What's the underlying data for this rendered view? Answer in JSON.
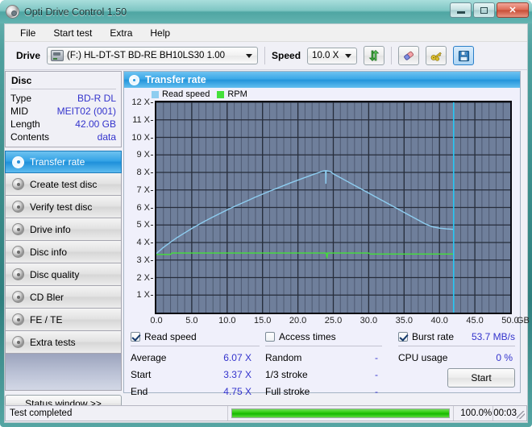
{
  "window": {
    "title": "Opti Drive Control 1.50",
    "icon": "disc-icon",
    "controls": {
      "minimize": "minimize",
      "maximize": "maximize",
      "close": "close"
    }
  },
  "menu": {
    "items": [
      "File",
      "Start test",
      "Extra",
      "Help"
    ]
  },
  "toolbar": {
    "drive_label": "Drive",
    "drive_value": "(F:)  HL-DT-ST BD-RE  BH10LS30 1.00",
    "speed_label": "Speed",
    "speed_value": "10.0 X",
    "buttons": [
      {
        "name": "refresh-button",
        "icon": "refresh-arrows-icon"
      },
      {
        "name": "erase-button",
        "icon": "eraser-icon"
      },
      {
        "name": "tools-button",
        "icon": "keys-icon"
      },
      {
        "name": "save-button",
        "icon": "floppy-disk-icon",
        "active": true
      }
    ]
  },
  "disc": {
    "title": "Disc",
    "rows": [
      {
        "key": "Type",
        "value": "BD-R DL"
      },
      {
        "key": "MID",
        "value": "MEIT02 (001)"
      },
      {
        "key": "Length",
        "value": "42.00 GB"
      },
      {
        "key": "Contents",
        "value": "data"
      }
    ]
  },
  "tabs": [
    {
      "label": "Transfer rate",
      "selected": true
    },
    {
      "label": "Create test disc",
      "selected": false
    },
    {
      "label": "Verify test disc",
      "selected": false
    },
    {
      "label": "Drive info",
      "selected": false
    },
    {
      "label": "Disc info",
      "selected": false
    },
    {
      "label": "Disc quality",
      "selected": false
    },
    {
      "label": "CD Bler",
      "selected": false
    },
    {
      "label": "FE / TE",
      "selected": false
    },
    {
      "label": "Extra tests",
      "selected": false
    }
  ],
  "status_window_button": "Status window >>",
  "panel": {
    "title": "Transfer rate"
  },
  "stats": {
    "read_speed": {
      "label": "Read speed",
      "checked": true,
      "rows": [
        {
          "key": "Average",
          "value": "6.07 X"
        },
        {
          "key": "Start",
          "value": "3.37 X"
        },
        {
          "key": "End",
          "value": "4.75 X"
        }
      ]
    },
    "access_times": {
      "label": "Access times",
      "checked": false,
      "rows": [
        {
          "key": "Random",
          "value": "-"
        },
        {
          "key": "1/3 stroke",
          "value": "-"
        },
        {
          "key": "Full stroke",
          "value": "-"
        }
      ]
    },
    "burst_rate": {
      "label": "Burst rate",
      "checked": true,
      "value": "53.7 MB/s",
      "cpu_key": "CPU usage",
      "cpu_value": "0 %"
    },
    "start_button": "Start"
  },
  "statusbar": {
    "text": "Test completed",
    "percent_label": "100.0%",
    "percent": 100,
    "time": "00:03"
  },
  "colors": {
    "read_speed": "#8ecdf0",
    "rpm": "#44e03a",
    "plot_bg": "#6f7f9b",
    "grid": "#3b4456",
    "marker": "#27c8f5",
    "value_text": "#3333cc",
    "accent": "#2394db"
  },
  "chart_data": {
    "type": "line",
    "title": "Transfer rate",
    "xlabel": "GB",
    "ylabel": "X",
    "xlim": [
      0.0,
      50.0
    ],
    "ylim": [
      0.0,
      12.0
    ],
    "xticks": [
      "0.0",
      "5.0",
      "10.0",
      "15.0",
      "20.0",
      "25.0",
      "30.0",
      "35.0",
      "40.0",
      "45.0",
      "50.0"
    ],
    "xtick_values": [
      0,
      5,
      10,
      15,
      20,
      25,
      30,
      35,
      40,
      45,
      50
    ],
    "yticks": [
      "1 X",
      "2 X",
      "3 X",
      "4 X",
      "5 X",
      "6 X",
      "7 X",
      "8 X",
      "9 X",
      "10 X",
      "11 X",
      "12 X"
    ],
    "ytick_values": [
      1,
      2,
      3,
      4,
      5,
      6,
      7,
      8,
      9,
      10,
      11,
      12
    ],
    "grid": true,
    "legend": [
      "Read speed",
      "RPM"
    ],
    "legend_position": "top-left",
    "marker_x": 42.0,
    "series": [
      {
        "name": "Read speed",
        "color": "#8ecdf0",
        "points": [
          [
            0.0,
            3.37
          ],
          [
            1.0,
            3.72
          ],
          [
            2.0,
            4.02
          ],
          [
            3.0,
            4.3
          ],
          [
            4.0,
            4.55
          ],
          [
            5.0,
            4.8
          ],
          [
            6.0,
            5.03
          ],
          [
            7.0,
            5.25
          ],
          [
            8.0,
            5.46
          ],
          [
            9.0,
            5.66
          ],
          [
            10.0,
            5.86
          ],
          [
            11.0,
            6.05
          ],
          [
            12.0,
            6.23
          ],
          [
            13.0,
            6.41
          ],
          [
            14.0,
            6.59
          ],
          [
            15.0,
            6.76
          ],
          [
            16.0,
            6.93
          ],
          [
            17.0,
            7.09
          ],
          [
            18.0,
            7.25
          ],
          [
            19.0,
            7.41
          ],
          [
            20.0,
            7.56
          ],
          [
            21.0,
            7.71
          ],
          [
            22.0,
            7.86
          ],
          [
            23.0,
            8.0
          ],
          [
            23.5,
            8.07
          ],
          [
            23.9,
            8.1
          ],
          [
            23.95,
            7.35
          ],
          [
            24.0,
            8.1
          ],
          [
            24.6,
            8.05
          ],
          [
            25.0,
            7.92
          ],
          [
            26.0,
            7.7
          ],
          [
            27.0,
            7.48
          ],
          [
            28.0,
            7.26
          ],
          [
            29.0,
            7.04
          ],
          [
            30.0,
            6.82
          ],
          [
            31.0,
            6.6
          ],
          [
            32.0,
            6.38
          ],
          [
            33.0,
            6.16
          ],
          [
            34.0,
            5.94
          ],
          [
            35.0,
            5.72
          ],
          [
            36.0,
            5.5
          ],
          [
            37.0,
            5.28
          ],
          [
            38.0,
            5.06
          ],
          [
            39.0,
            4.9
          ],
          [
            40.0,
            4.82
          ],
          [
            41.0,
            4.78
          ],
          [
            42.0,
            4.75
          ]
        ]
      },
      {
        "name": "RPM",
        "color": "#44e03a",
        "points": [
          [
            0.0,
            3.32
          ],
          [
            2.0,
            3.32
          ],
          [
            2.2,
            3.4
          ],
          [
            12.0,
            3.4
          ],
          [
            24.0,
            3.4
          ],
          [
            24.1,
            3.1
          ],
          [
            24.2,
            3.4
          ],
          [
            30.0,
            3.4
          ],
          [
            30.2,
            3.34
          ],
          [
            42.0,
            3.34
          ]
        ]
      }
    ]
  }
}
